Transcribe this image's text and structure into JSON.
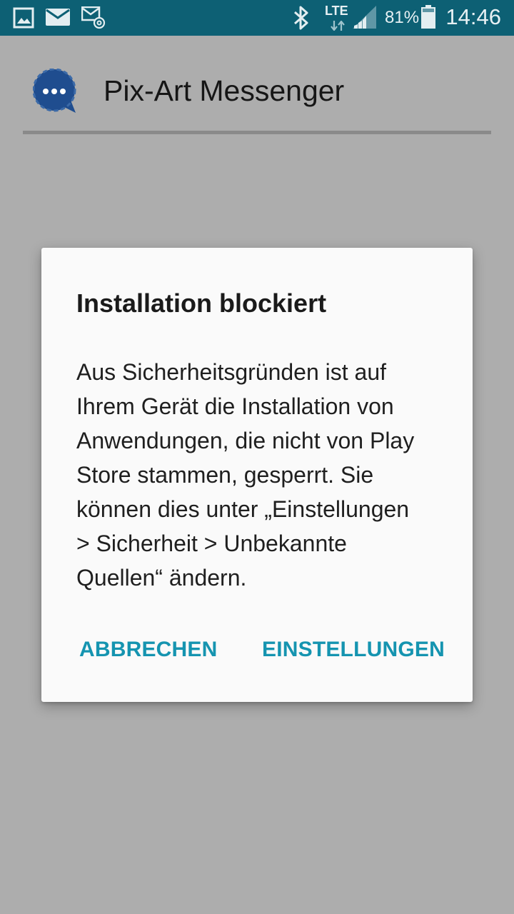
{
  "status_bar": {
    "time": "14:46",
    "battery_percent": "81%",
    "network_label": "LTE",
    "icons": [
      "gallery-icon",
      "email-icon",
      "email-at-icon",
      "bluetooth-icon",
      "lte-data-icon",
      "signal-icon",
      "battery-icon"
    ]
  },
  "app_bar": {
    "title": "Pix-Art Messenger",
    "icon": "chat-bubble-icon"
  },
  "dialog": {
    "title": "Installation blockiert",
    "body_lines": [
      "Aus Sicherheitsgründen ist auf",
      "Ihrem Gerät die Installation von",
      "Anwendungen, die nicht von Play",
      "Store stammen, gesperrt. Sie",
      "können dies unter „Einstellungen",
      "> Sicherheit > Unbekannte",
      "Quellen“ ändern."
    ],
    "cancel_label": "ABBRECHEN",
    "settings_label": "EINSTELLUNGEN"
  },
  "colors": {
    "status_bar": "#0d6074",
    "scrim_background": "#adadad",
    "dialog_background": "#fafafa",
    "button_accent": "#1594b0",
    "app_icon": "#1f4d8f"
  }
}
